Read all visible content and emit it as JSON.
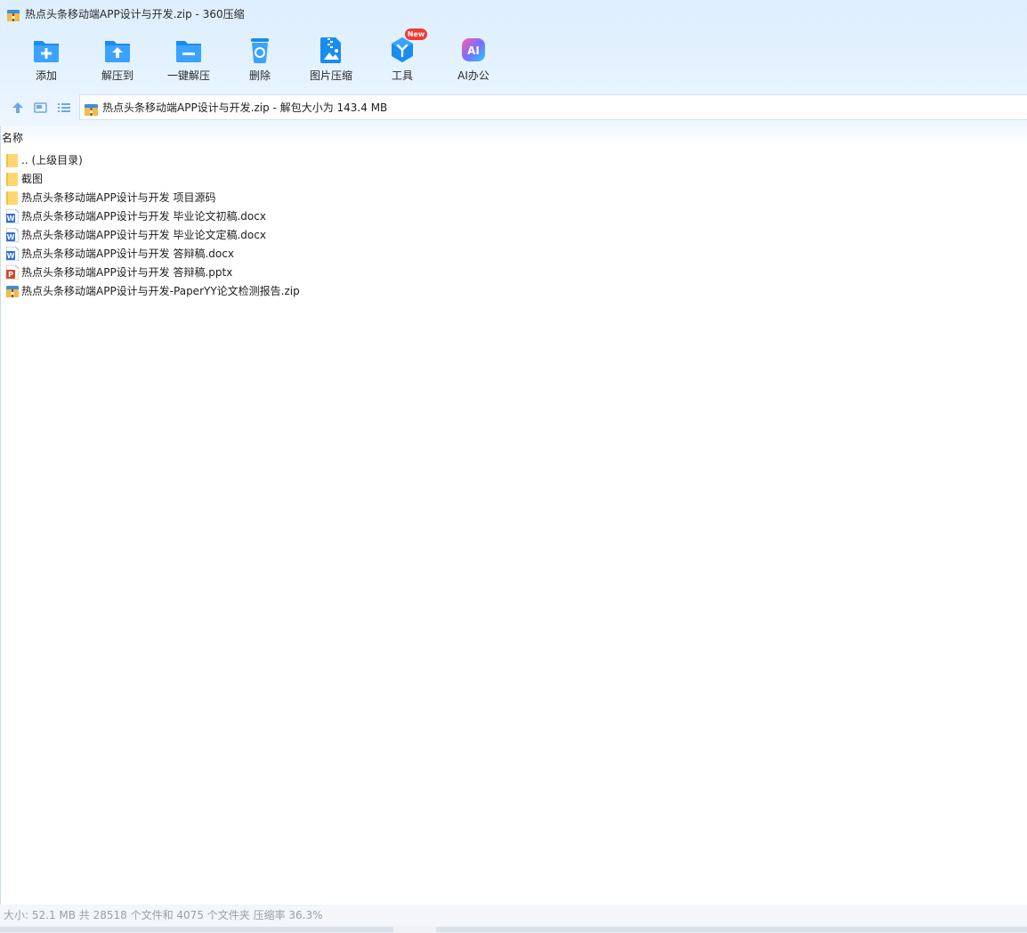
{
  "window": {
    "title": "热点头条移动端APP设计与开发.zip - 360压缩"
  },
  "toolbar": {
    "items": [
      {
        "label": "添加",
        "icon": "add-icon"
      },
      {
        "label": "解压到",
        "icon": "extract-to-icon"
      },
      {
        "label": "一键解压",
        "icon": "one-click-extract-icon"
      },
      {
        "label": "删除",
        "icon": "delete-icon"
      },
      {
        "label": "图片压缩",
        "icon": "image-compress-icon"
      },
      {
        "label": "工具",
        "icon": "tools-icon",
        "badge": "New"
      },
      {
        "label": "AI办公",
        "icon": "ai-office-icon",
        "icon_text": "AI"
      }
    ]
  },
  "nav": {
    "path": "热点头条移动端APP设计与开发.zip - 解包大小为 143.4 MB"
  },
  "list": {
    "column_header": "名称",
    "rows": [
      {
        "name": ".. (上级目录)",
        "type": "folder"
      },
      {
        "name": "截图",
        "type": "folder"
      },
      {
        "name": "热点头条移动端APP设计与开发 项目源码",
        "type": "folder"
      },
      {
        "name": "热点头条移动端APP设计与开发 毕业论文初稿.docx",
        "type": "word"
      },
      {
        "name": "热点头条移动端APP设计与开发 毕业论文定稿.docx",
        "type": "word"
      },
      {
        "name": "热点头条移动端APP设计与开发 答辩稿.docx",
        "type": "word"
      },
      {
        "name": "热点头条移动端APP设计与开发 答辩稿.pptx",
        "type": "ppt"
      },
      {
        "name": "热点头条移动端APP设计与开发-PaperYY论文检测报告.zip",
        "type": "zip"
      }
    ]
  },
  "status": {
    "text": "大小: 52.1 MB 共 28518 个文件和 4075 个文件夹 压缩率 36.3%"
  },
  "colors": {
    "accent_blue": "#1a8cf0",
    "badge_red": "#f23a32",
    "folder_yellow": "#ffd771"
  }
}
